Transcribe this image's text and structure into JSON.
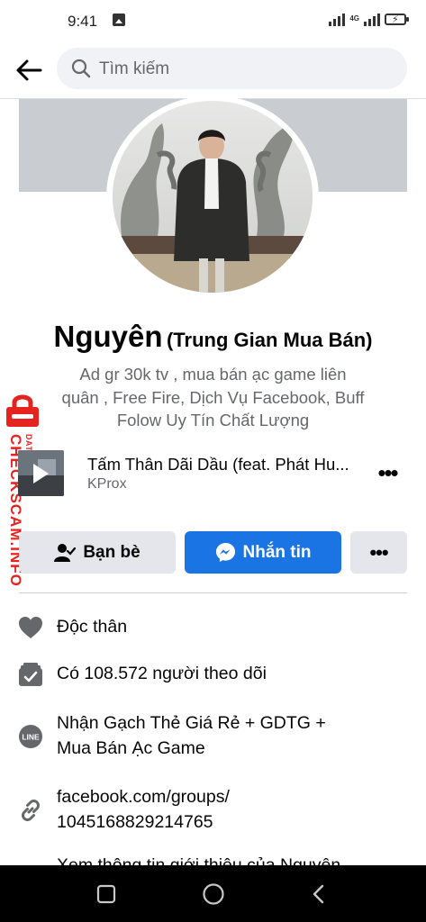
{
  "status_bar": {
    "time": "9:41",
    "network": "4G"
  },
  "search": {
    "placeholder": "Tìm kiếm"
  },
  "profile": {
    "name": "Nguyên",
    "alternate_name": "(Trung Gian Mua Bán)",
    "bio_lines": [
      "Ad gr 30k tv , mua bán ạc game liên",
      "quân , Free Fire, Dịch Vụ Facebook, Buff",
      "Folow Uy Tín Chất Lượng"
    ]
  },
  "watermark": {
    "brand": "CHECKSCAM.INFO",
    "sub": "DATA CENTER"
  },
  "music": {
    "title": "Tấm Thân Dãi Dầu (feat. Phát Hu...",
    "artist": "KProx"
  },
  "actions": {
    "friends_label": "Bạn bè",
    "message_label": "Nhắn tin"
  },
  "details": {
    "relationship": "Độc thân",
    "followers": "Có 108.572 người theo dõi",
    "line_lines": [
      "Nhận Gạch Thẻ Giá Rẻ + GDTG +",
      "Mua Bán Ạc Game"
    ],
    "link_lines": [
      "facebook.com/groups/",
      "1045168829214765"
    ],
    "about": "Xem thông tin giới thiệu của Nguyên"
  },
  "colors": {
    "accent": "#1b74e4",
    "secondary_button": "#e4e6eb",
    "secondary_text": "#65676b",
    "watermark": "#e52420"
  }
}
